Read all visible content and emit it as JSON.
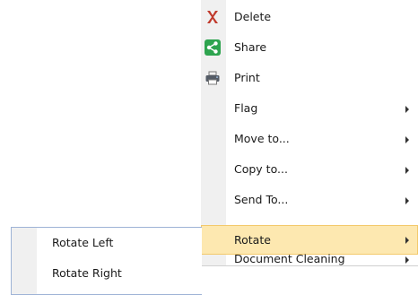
{
  "context_menu": {
    "items": [
      {
        "label": "Delete",
        "icon": "delete-x-icon",
        "has_submenu": false
      },
      {
        "label": "Share",
        "icon": "share-icon",
        "has_submenu": false
      },
      {
        "label": "Print",
        "icon": "printer-icon",
        "has_submenu": false
      },
      {
        "label": "Flag",
        "icon": "",
        "has_submenu": true
      },
      {
        "label": "Move to...",
        "icon": "",
        "has_submenu": true
      },
      {
        "label": "Copy to...",
        "icon": "",
        "has_submenu": true
      },
      {
        "label": "Send To...",
        "icon": "",
        "has_submenu": true
      },
      {
        "label": "Rotate",
        "icon": "",
        "has_submenu": true,
        "highlighted": true
      },
      {
        "label": "Document Cleaning",
        "icon": "",
        "has_submenu": true
      }
    ]
  },
  "rotate_submenu": {
    "items": [
      {
        "label": "Rotate Left"
      },
      {
        "label": "Rotate Right"
      }
    ]
  },
  "colors": {
    "highlight_background": "#fde8b0",
    "highlight_border": "#f3c96b",
    "gutter": "#f0f0f0",
    "delete_icon": "#c0392b",
    "share_icon": "#2ea44f",
    "submenu_border": "#9eb3d6"
  }
}
